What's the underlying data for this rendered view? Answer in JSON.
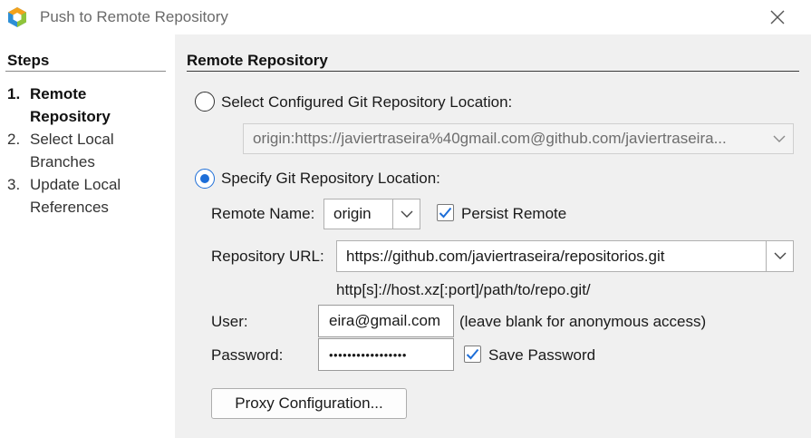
{
  "window": {
    "title": "Push to Remote Repository",
    "icon": "netbeans-cube-icon",
    "close_icon": "close-icon"
  },
  "steps": {
    "heading": "Steps",
    "items": [
      {
        "number": "1.",
        "label": "Remote Repository",
        "active": true
      },
      {
        "number": "2.",
        "label": "Select Local Branches",
        "active": false
      },
      {
        "number": "3.",
        "label": "Update Local References",
        "active": false
      }
    ]
  },
  "main": {
    "heading": "Remote Repository",
    "configured_option": {
      "label": "Select Configured Git Repository Location:",
      "selected": false,
      "value": "origin:https://javiertraseira%40gmail.com@github.com/javiertraseira..."
    },
    "specify_option": {
      "label": "Specify Git Repository Location:",
      "selected": true
    },
    "remote_name": {
      "label": "Remote Name:",
      "value": "origin"
    },
    "persist_remote": {
      "label": "Persist Remote",
      "checked": true
    },
    "repository_url": {
      "label": "Repository URL:",
      "value": "https://github.com/javiertraseira/repositorios.git",
      "hint": "http[s]://host.xz[:port]/path/to/repo.git/"
    },
    "user": {
      "label": "User:",
      "value": "eira@gmail.com",
      "hint": "(leave blank for anonymous access)"
    },
    "password": {
      "label": "Password:",
      "value": "•••••••••••••••••"
    },
    "save_password": {
      "label": "Save Password",
      "checked": true
    },
    "proxy_button": "Proxy Configuration..."
  },
  "colors": {
    "accent": "#1d6ed8",
    "panel_bg": "#f0f0f0",
    "title_text": "#6a6a6a"
  }
}
